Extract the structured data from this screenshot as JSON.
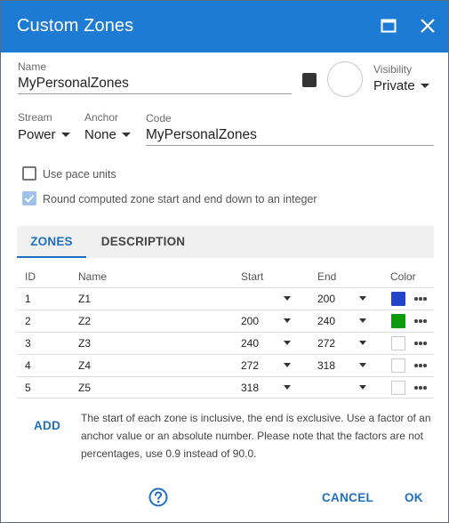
{
  "dialog": {
    "title": "Custom Zones"
  },
  "name_field": {
    "label": "Name",
    "value": "MyPersonalZones"
  },
  "color_preview": "#333333",
  "visibility": {
    "label": "Visibility",
    "value": "Private"
  },
  "stream": {
    "label": "Stream",
    "value": "Power"
  },
  "anchor": {
    "label": "Anchor",
    "value": "None"
  },
  "code_field": {
    "label": "Code",
    "value": "MyPersonalZones"
  },
  "options": {
    "pace_units": {
      "label": "Use pace units",
      "checked": false
    },
    "round_down": {
      "label": "Round computed zone start and end down to an integer",
      "checked": true
    }
  },
  "tabs": [
    {
      "label": "ZONES",
      "active": true
    },
    {
      "label": "DESCRIPTION",
      "active": false
    }
  ],
  "table": {
    "headers": {
      "id": "ID",
      "name": "Name",
      "start": "Start",
      "end": "End",
      "color": "Color"
    },
    "rows": [
      {
        "id": "1",
        "name": "Z1",
        "start": "",
        "end": "200",
        "color": "#2345c8"
      },
      {
        "id": "2",
        "name": "Z2",
        "start": "200",
        "end": "240",
        "color": "#0a9a0a"
      },
      {
        "id": "3",
        "name": "Z3",
        "start": "240",
        "end": "272",
        "color": ""
      },
      {
        "id": "4",
        "name": "Z4",
        "start": "272",
        "end": "318",
        "color": ""
      },
      {
        "id": "5",
        "name": "Z5",
        "start": "318",
        "end": "",
        "color": ""
      }
    ]
  },
  "add_label": "ADD",
  "note": "The start of each zone is inclusive, the end is exclusive. Use a factor of an anchor value or an absolute number. Please note that the factors are not percentages, use 0.9 instead of 90.0.",
  "footer": {
    "cancel": "CANCEL",
    "ok": "OK"
  },
  "icons": {
    "maximize": "maximize-icon",
    "close": "close-icon",
    "help": "help-icon",
    "more": "more-horizontal-icon"
  },
  "colors": {
    "accent": "#1e7bd3",
    "link": "#1e6fc2"
  }
}
